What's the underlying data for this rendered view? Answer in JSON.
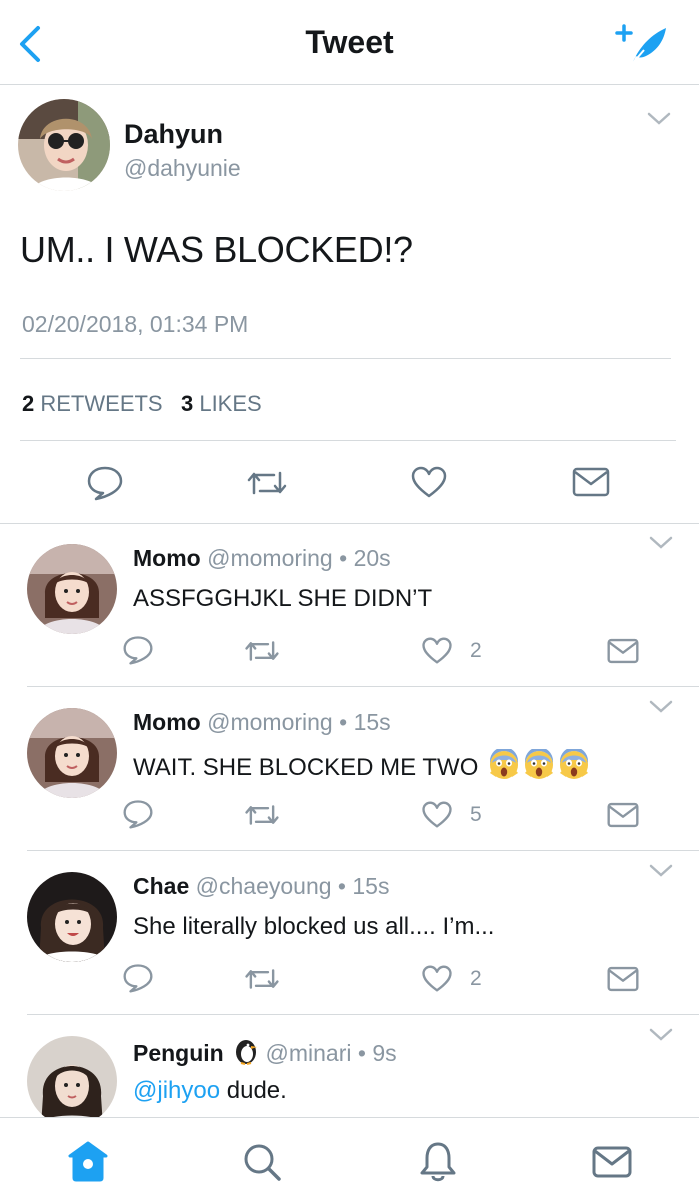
{
  "header": {
    "title": "Tweet"
  },
  "tweet": {
    "name": "Dahyun",
    "handle": "@dahyunie",
    "text": "UM.. I WAS BLOCKED!?",
    "timestamp": "02/20/2018, 01:34 PM",
    "retweets_count": "2",
    "retweets_label": "RETWEETS",
    "likes_count": "3",
    "likes_label": "LIKES"
  },
  "replies": [
    {
      "name": "Momo",
      "handle": "@momoring",
      "time": "20s",
      "text": "ASSFGGHJKL SHE DIDN’T",
      "likes": "2"
    },
    {
      "name": "Momo",
      "handle": "@momoring",
      "time": "15s",
      "text": "WAIT. SHE BLOCKED ME TWO",
      "likes": "5"
    },
    {
      "name": "Chae",
      "handle": "@chaeyoung",
      "time": "15s",
      "text": "She literally blocked us all.... I’m...",
      "likes": "2"
    },
    {
      "name": "Penguin",
      "handle": "@minari",
      "time": "9s",
      "mention": "@jihyoo",
      "text": "dude."
    }
  ],
  "colors": {
    "accent": "#1da1f2",
    "text": "#14171a",
    "secondary": "#8a96a1",
    "divider": "#d6dadd"
  },
  "tabbar": [
    "home-icon",
    "search-icon",
    "notifications-icon",
    "messages-icon"
  ]
}
